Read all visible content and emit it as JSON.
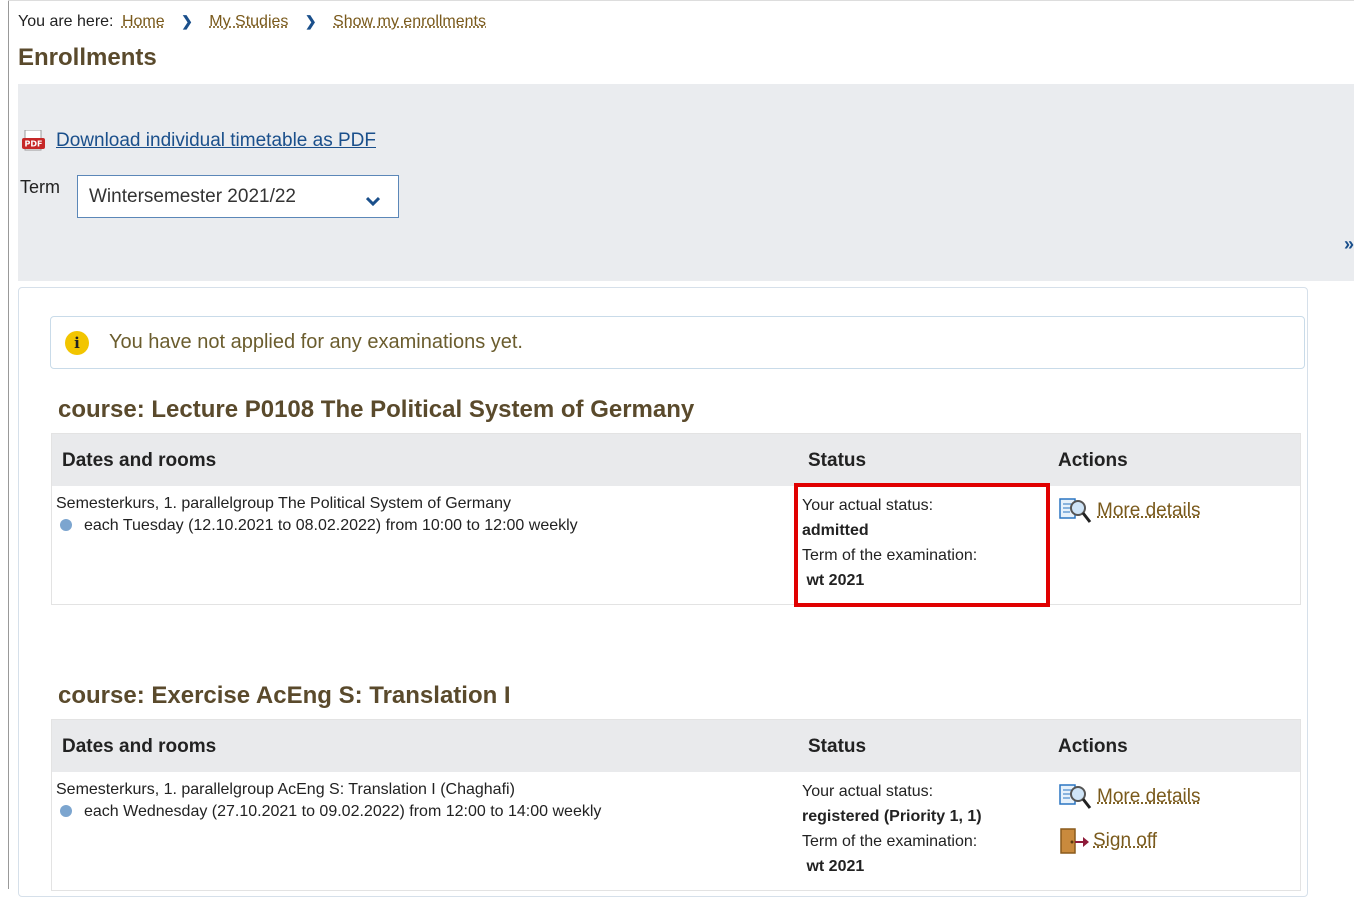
{
  "breadcrumb": {
    "prefix": "You are here:",
    "items": [
      "Home",
      "My Studies",
      "Show my enrollments"
    ]
  },
  "page_title": "Enrollments",
  "filter": {
    "pdf_link": "Download individual timetable as PDF",
    "term_label": "Term",
    "term_value": "Wintersemester 2021/22"
  },
  "info_message": "You have not applied for any examinations yet.",
  "table_headers": {
    "dates": "Dates and rooms",
    "status": "Status",
    "actions": "Actions"
  },
  "courses": [
    {
      "title": "course: Lecture P0108 The Political System of Germany",
      "group": "Semesterkurs, 1. parallelgroup The Political System of Germany",
      "schedule": "each Tuesday (12.10.2021 to 08.02.2022) from 10:00 to 12:00 weekly",
      "status_label": "Your actual status:",
      "status_value": "admitted",
      "exam_term_label": "Term of the examination:",
      "exam_term_value": "wt 2021",
      "actions": [
        "More details"
      ]
    },
    {
      "title": "course: Exercise AcEng S: Translation I",
      "group": "Semesterkurs, 1. parallelgroup AcEng S: Translation I (Chaghafi)",
      "schedule": "each Wednesday (27.10.2021 to 09.02.2022) from 12:00 to 14:00 weekly",
      "status_label": "Your actual status:",
      "status_value": "registered (Priority 1, 1)",
      "exam_term_label": "Term of the examination:",
      "exam_term_value": "wt 2021",
      "actions": [
        "More details",
        "Sign off"
      ]
    }
  ],
  "icons": {
    "pdf": "pdf-icon",
    "select": "chevron-down-icon",
    "info": "info-icon",
    "details": "magnifier-document-icon",
    "sign_off": "door-exit-icon"
  },
  "colors": {
    "link": "#1a4f8b",
    "title": "#5a4a2c",
    "highlight": "#e00000",
    "panel_bg": "#eaecef",
    "info_icon": "#f2c500"
  }
}
